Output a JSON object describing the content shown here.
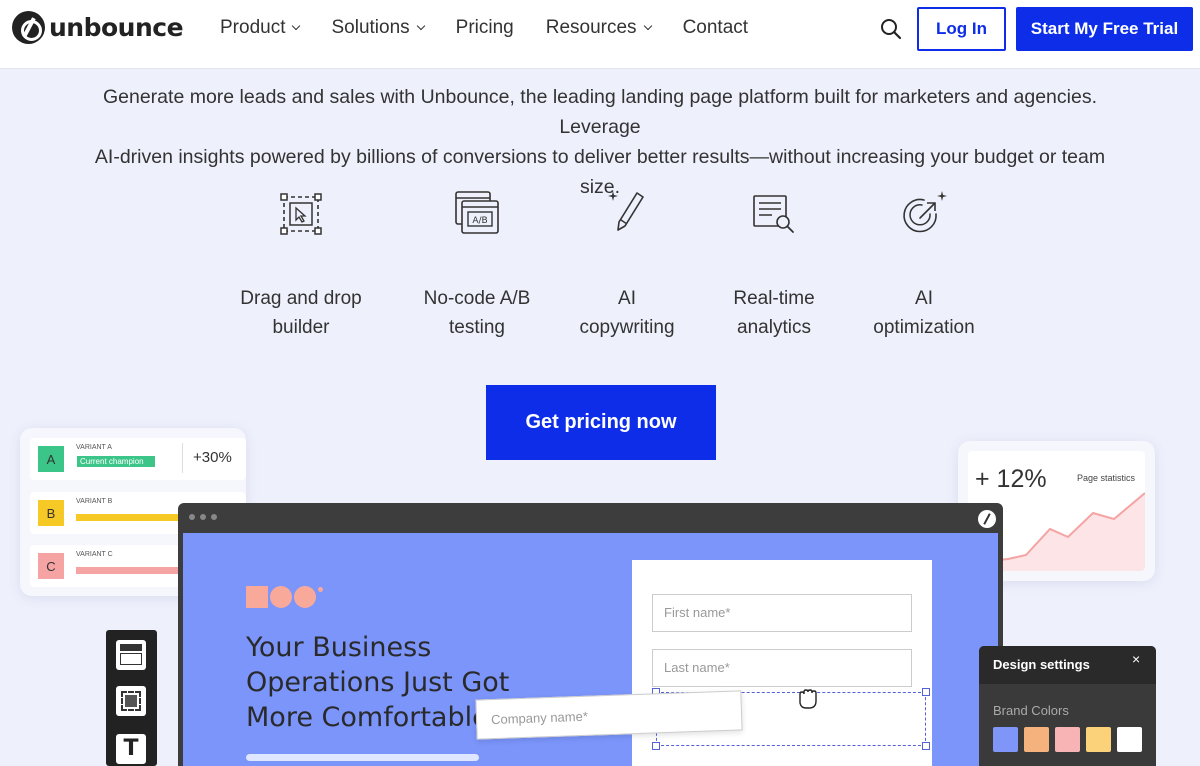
{
  "nav": {
    "logo_text": "unbounce",
    "menu": [
      {
        "label": "Product",
        "dropdown": true
      },
      {
        "label": "Solutions",
        "dropdown": true
      },
      {
        "label": "Pricing",
        "dropdown": false
      },
      {
        "label": "Resources",
        "dropdown": true
      },
      {
        "label": "Contact",
        "dropdown": false
      }
    ],
    "search_icon": "search-icon",
    "login_label": "Log In",
    "trial_label": "Start My Free Trial"
  },
  "hero": {
    "lead_line1": "Generate more leads and sales with Unbounce, the leading landing page platform built for marketers and agencies. Leverage",
    "lead_line2": "AI-driven insights powered by billions of conversions to deliver better results—without increasing your budget or team size."
  },
  "features": [
    {
      "icon": "drag-drop-icon",
      "line1": "Drag and drop",
      "line2": "builder"
    },
    {
      "icon": "ab-test-icon",
      "line1": "No-code A/B",
      "line2": "testing"
    },
    {
      "icon": "ai-pen-icon",
      "line1": "AI",
      "line2": "copywriting"
    },
    {
      "icon": "analytics-icon",
      "line1": "Real-time",
      "line2": "analytics"
    },
    {
      "icon": "ai-target-icon",
      "line1": "AI",
      "line2": "optimization"
    }
  ],
  "cta_label": "Get pricing now",
  "variants_card": {
    "rows": [
      {
        "badge": "A",
        "name": "VARIANT A",
        "tag": "Current champion",
        "pct": "+30%"
      },
      {
        "badge": "B",
        "name": "VARIANT B"
      },
      {
        "badge": "C",
        "name": "VARIANT C"
      }
    ]
  },
  "stats_card": {
    "value": "+ 12%",
    "title": "Page statistics"
  },
  "mockup": {
    "headline": [
      "Your Business",
      "Operations Just Got",
      "More Comfortable"
    ],
    "form": {
      "first_name": "First name*",
      "last_name": "Last name*",
      "company": "Company name*"
    }
  },
  "design_panel": {
    "title": "Design settings",
    "close": "×",
    "brand_label": "Brand Colors",
    "swatches": [
      "#7f95f7",
      "#f6b27c",
      "#f8b4b4",
      "#fbd27a",
      "#ffffff"
    ]
  },
  "colors": {
    "primary": "#0d2de8",
    "background": "#eef0fc",
    "canvas": "#7b95fb"
  }
}
